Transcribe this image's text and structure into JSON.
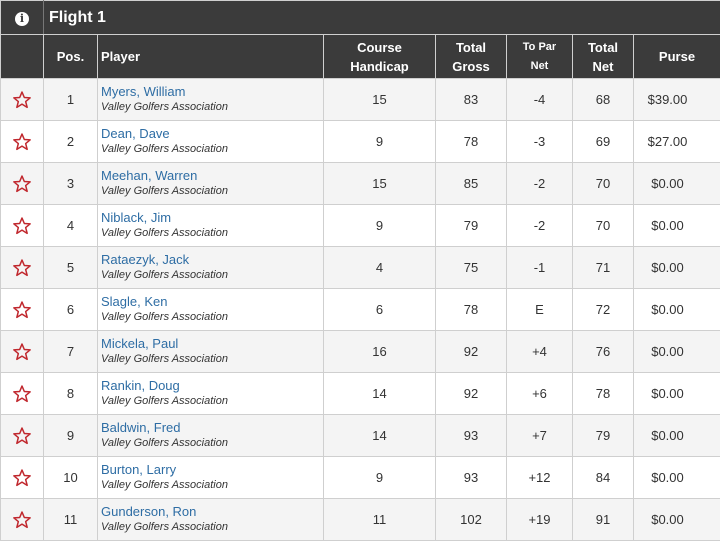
{
  "flight": {
    "title": "Flight 1",
    "info_icon": "info-icon"
  },
  "columns": {
    "pos": "Pos.",
    "player": "Player",
    "course_handicap_1": "Course",
    "course_handicap_2": "Handicap",
    "total_gross_1": "Total",
    "total_gross_2": "Gross",
    "to_par_net_1": "To Par",
    "to_par_net_2": "Net",
    "total_net_1": "Total",
    "total_net_2": "Net",
    "purse": "Purse"
  },
  "colors": {
    "negative": "#c0272d",
    "even": "#2e8b2e",
    "positive": "#8a2ea8",
    "star": "#c0272d",
    "header": "#3b3b3b"
  },
  "rows": [
    {
      "pos": "1",
      "name": "Myers, William",
      "assoc": "Valley Golfers Association",
      "handicap": "15",
      "gross": "83",
      "to_par": "-4",
      "net": "68",
      "purse": "$39.00",
      "status": "neg"
    },
    {
      "pos": "2",
      "name": "Dean, Dave",
      "assoc": "Valley Golfers Association",
      "handicap": "9",
      "gross": "78",
      "to_par": "-3",
      "net": "69",
      "purse": "$27.00",
      "status": "neg"
    },
    {
      "pos": "3",
      "name": "Meehan, Warren",
      "assoc": "Valley Golfers Association",
      "handicap": "15",
      "gross": "85",
      "to_par": "-2",
      "net": "70",
      "purse": "$0.00",
      "status": "neg"
    },
    {
      "pos": "4",
      "name": "Niblack, Jim",
      "assoc": "Valley Golfers Association",
      "handicap": "9",
      "gross": "79",
      "to_par": "-2",
      "net": "70",
      "purse": "$0.00",
      "status": "neg"
    },
    {
      "pos": "5",
      "name": "Rataezyk, Jack",
      "assoc": "Valley Golfers Association",
      "handicap": "4",
      "gross": "75",
      "to_par": "-1",
      "net": "71",
      "purse": "$0.00",
      "status": "neg"
    },
    {
      "pos": "6",
      "name": "Slagle, Ken",
      "assoc": "Valley Golfers Association",
      "handicap": "6",
      "gross": "78",
      "to_par": "E",
      "net": "72",
      "purse": "$0.00",
      "status": "even"
    },
    {
      "pos": "7",
      "name": "Mickela, Paul",
      "assoc": "Valley Golfers Association",
      "handicap": "16",
      "gross": "92",
      "to_par": "+4",
      "net": "76",
      "purse": "$0.00",
      "status": "pos"
    },
    {
      "pos": "8",
      "name": "Rankin, Doug",
      "assoc": "Valley Golfers Association",
      "handicap": "14",
      "gross": "92",
      "to_par": "+6",
      "net": "78",
      "purse": "$0.00",
      "status": "pos"
    },
    {
      "pos": "9",
      "name": "Baldwin, Fred",
      "assoc": "Valley Golfers Association",
      "handicap": "14",
      "gross": "93",
      "to_par": "+7",
      "net": "79",
      "purse": "$0.00",
      "status": "pos"
    },
    {
      "pos": "10",
      "name": "Burton, Larry",
      "assoc": "Valley Golfers Association",
      "handicap": "9",
      "gross": "93",
      "to_par": "+12",
      "net": "84",
      "purse": "$0.00",
      "status": "pos"
    },
    {
      "pos": "11",
      "name": "Gunderson, Ron",
      "assoc": "Valley Golfers Association",
      "handicap": "11",
      "gross": "102",
      "to_par": "+19",
      "net": "91",
      "purse": "$0.00",
      "status": "pos"
    }
  ]
}
